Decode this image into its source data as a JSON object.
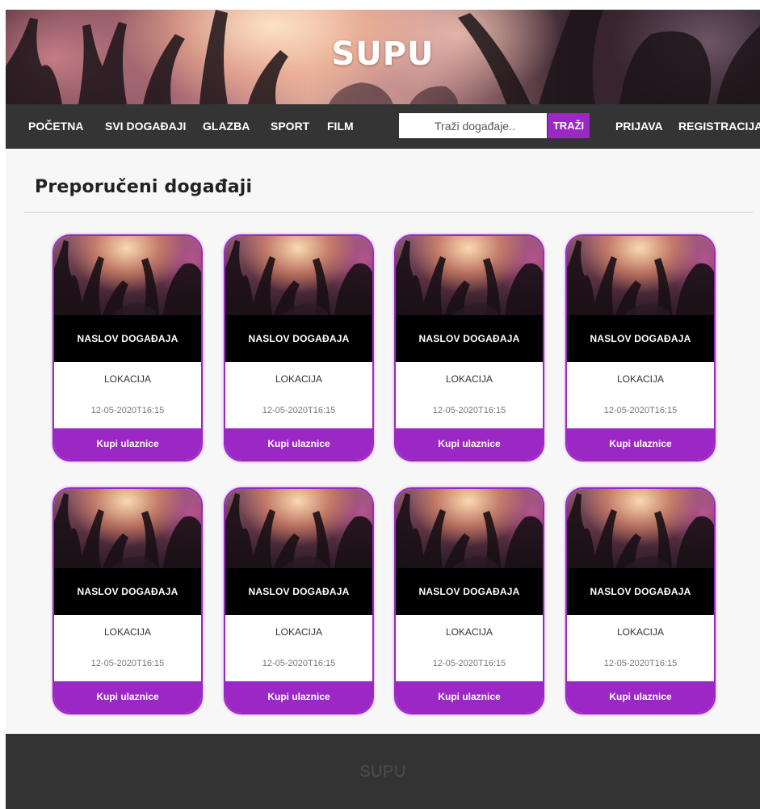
{
  "header": {
    "brand": "SUPU"
  },
  "nav": {
    "items": [
      "POČETNA",
      "SVI DOGAĐAJI",
      "GLAZBA",
      "SPORT",
      "FILM"
    ],
    "search_placeholder": "Traži događaje..",
    "search_button": "TRAŽI",
    "login": "PRIJAVA",
    "register": "REGISTRACIJA"
  },
  "main": {
    "section_title": "Preporučeni događaji",
    "events": [
      {
        "title": "NASLOV DOGAĐAJA",
        "location": "LOKACIJA",
        "date": "12-05-2020T16:15",
        "buy": "Kupi ulaznice"
      },
      {
        "title": "NASLOV DOGAĐAJA",
        "location": "LOKACIJA",
        "date": "12-05-2020T16:15",
        "buy": "Kupi ulaznice"
      },
      {
        "title": "NASLOV DOGAĐAJA",
        "location": "LOKACIJA",
        "date": "12-05-2020T16:15",
        "buy": "Kupi ulaznice"
      },
      {
        "title": "NASLOV DOGAĐAJA",
        "location": "LOKACIJA",
        "date": "12-05-2020T16:15",
        "buy": "Kupi ulaznice"
      },
      {
        "title": "NASLOV DOGAĐAJA",
        "location": "LOKACIJA",
        "date": "12-05-2020T16:15",
        "buy": "Kupi ulaznice"
      },
      {
        "title": "NASLOV DOGAĐAJA",
        "location": "LOKACIJA",
        "date": "12-05-2020T16:15",
        "buy": "Kupi ulaznice"
      },
      {
        "title": "NASLOV DOGAĐAJA",
        "location": "LOKACIJA",
        "date": "12-05-2020T16:15",
        "buy": "Kupi ulaznice"
      },
      {
        "title": "NASLOV DOGAĐAJA",
        "location": "LOKACIJA",
        "date": "12-05-2020T16:15",
        "buy": "Kupi ulaznice"
      }
    ]
  },
  "footer": {
    "brand": "SUPU"
  },
  "colors": {
    "accent": "#9b27c5",
    "nav_bg": "#343434",
    "footer_bg": "#333333",
    "card_title_bg": "#000000"
  }
}
